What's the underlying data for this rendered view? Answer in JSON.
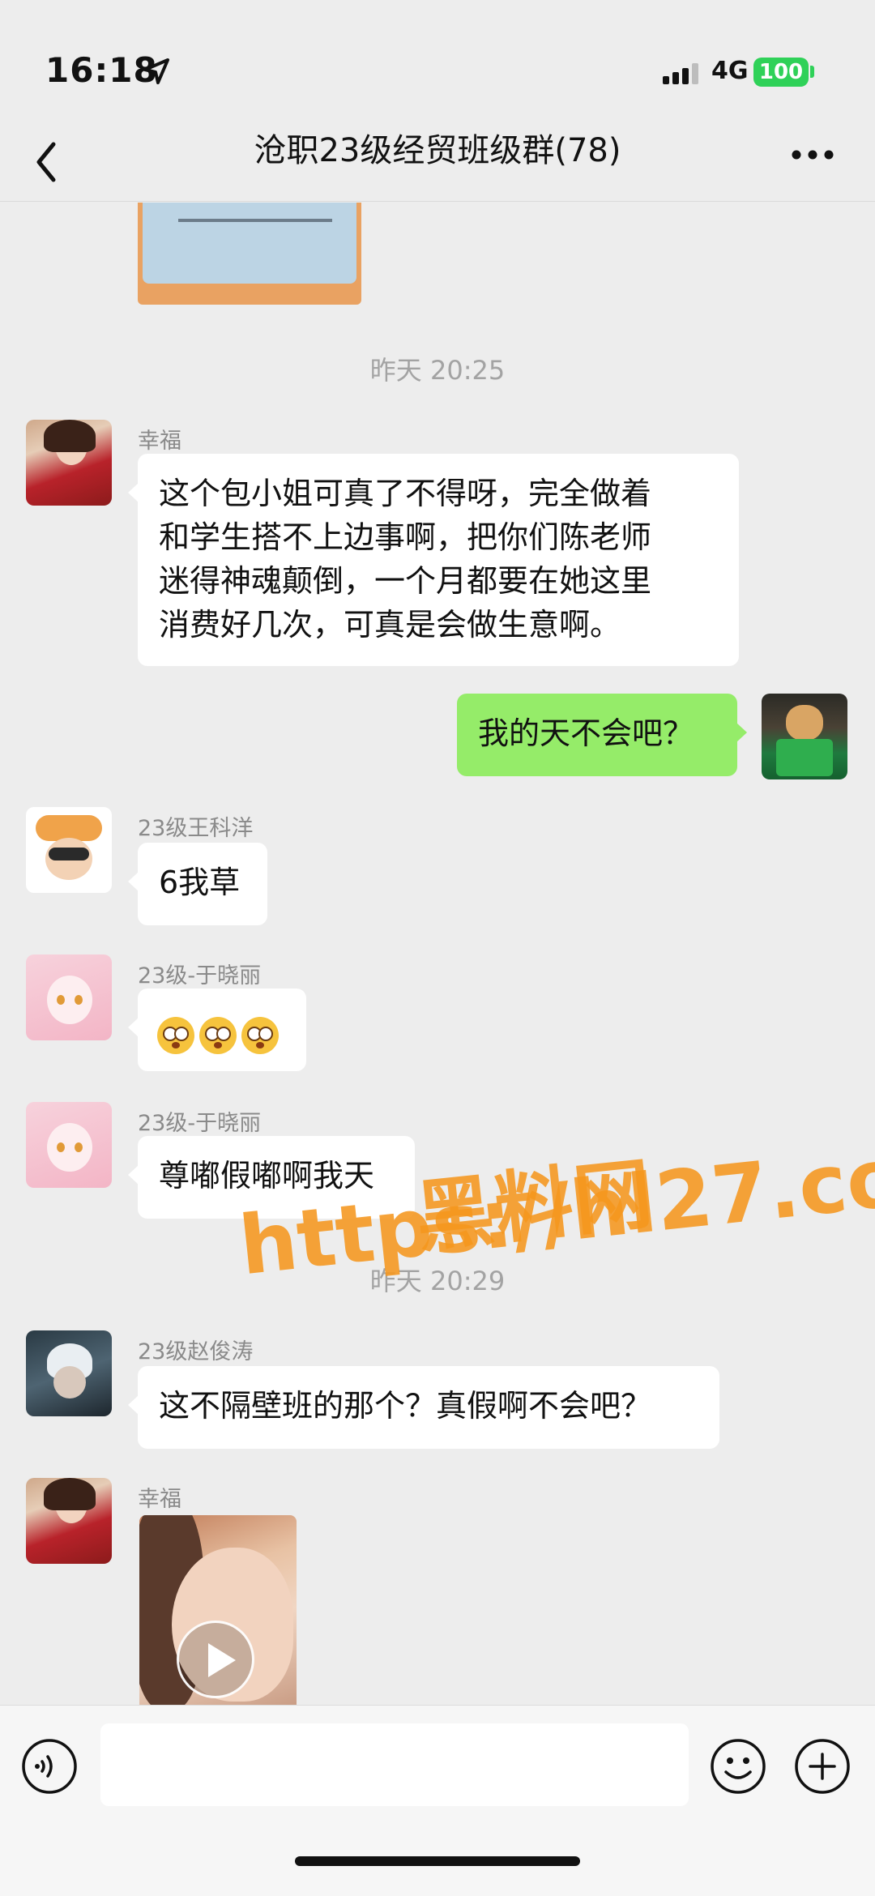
{
  "status": {
    "time": "16:18",
    "network": "4G",
    "battery": "100"
  },
  "header": {
    "title": "沧职23级经贸班级群(78)"
  },
  "messages": {
    "t1": "昨天 20:25",
    "m1": {
      "sender": "幸福",
      "text_lines": [
        "这个包小姐可真了不得呀，完全做着",
        "和学生搭不上边事啊，把你们陈老师",
        "迷得神魂颠倒，一个月都要在她这里",
        "消费好几次，可真是会做生意啊。"
      ]
    },
    "m2": {
      "text": "我的天不会吧？"
    },
    "m3": {
      "sender": "23级王科洋",
      "text": "6我草"
    },
    "m4": {
      "sender": "23级-于晓丽",
      "emoji": "flushed-face x3"
    },
    "m5": {
      "sender": "23级-于晓丽",
      "text": "尊嘟假嘟啊我天"
    },
    "t2": "昨天 20:29",
    "m6": {
      "sender": "23级赵俊涛",
      "text": "这不隔壁班的那个？真假啊不会吧？"
    },
    "m7": {
      "sender": "幸福",
      "type": "video"
    }
  },
  "watermark": {
    "line1": "黑料网",
    "line2": "https://hl27.co"
  },
  "colors": {
    "bg": "#ededed",
    "my_bubble": "#95ec69",
    "battery": "#2fd158",
    "watermark": "#f5961e"
  }
}
